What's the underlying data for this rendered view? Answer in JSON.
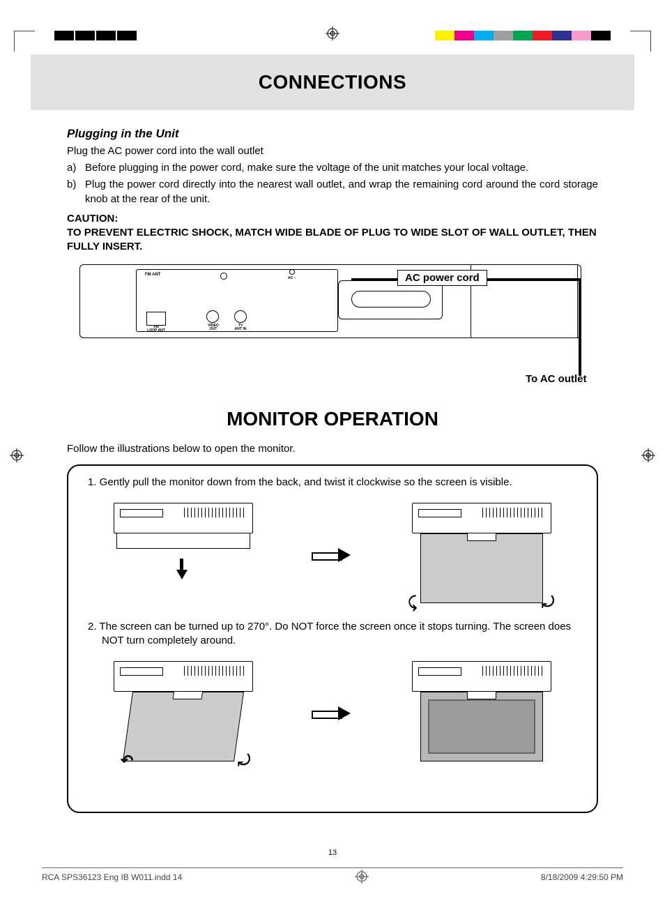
{
  "colorbars": [
    "#fff200",
    "#ec008c",
    "#00aeef",
    "#9e9e9e",
    "#00a651",
    "#ed1c24",
    "#2e3192",
    "#f59bca",
    "#000000"
  ],
  "title1": "CONNECTIONS",
  "plugging": {
    "heading": "Plugging in the Unit",
    "intro": "Plug the AC power cord into the wall outlet",
    "a_label": "a)",
    "a_text": "Before plugging in the power cord, make sure the voltage of the unit matches your local voltage.",
    "b_label": "b)",
    "b_text": "Plug the power cord directly into the nearest wall outlet, and wrap the remaining cord around the cord storage knob at the rear of the unit."
  },
  "caution": {
    "line1": "CAUTION:",
    "line2": "TO PREVENT ELECTRIC SHOCK, MATCH WIDE BLADE OF PLUG TO WIDE SLOT OF WALL OUTLET, THEN FULLY INSERT."
  },
  "rear": {
    "fm": "FM ANT",
    "am": "AM\nLOOP ANT",
    "video": "VIDEO\nOUT",
    "tv": "TV\nANT IN",
    "ac": "AC ~",
    "ac_cord_label": "AC power cord",
    "to_ac": "To AC outlet"
  },
  "title2": "MONITOR OPERATION",
  "follow": "Follow the illustrations below to open the monitor.",
  "step1": "1. Gently pull the monitor down from the back, and twist it clockwise so the screen is visible.",
  "step2_a": "2. The screen can be turned up to 270°. Do NOT force the screen once it stops turning. The screen does",
  "step2_b": "NOT turn completely around.",
  "pgnum": "13",
  "slug": {
    "file": "RCA SPS36123 Eng IB W011.indd   14",
    "date": "8/18/2009   4:29:50 PM"
  }
}
